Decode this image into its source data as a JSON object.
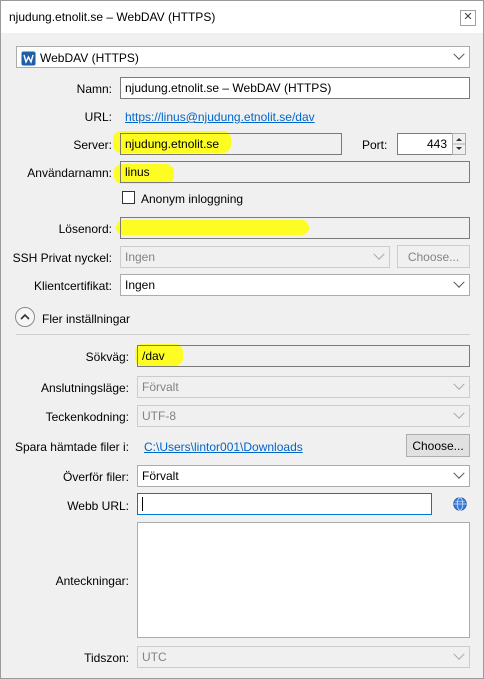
{
  "window": {
    "title": "njudung.etnolit.se – WebDAV (HTTPS)",
    "close_glyph": "✕"
  },
  "protocol": {
    "value": "WebDAV (HTTPS)"
  },
  "fields": {
    "name_label": "Namn:",
    "name_value": "njudung.etnolit.se – WebDAV (HTTPS)",
    "url_label": "URL:",
    "url_value": "https://linus@njudung.etnolit.se/dav",
    "server_label": "Server:",
    "server_value": "njudung.etnolit.se",
    "port_label": "Port:",
    "port_value": "443",
    "username_label": "Användarnamn:",
    "username_value": "linus",
    "anon_label": "Anonym inloggning",
    "password_label": "Lösenord:",
    "password_value": "",
    "ssh_label": "SSH Privat nyckel:",
    "ssh_value": "Ingen",
    "ssh_choose": "Choose...",
    "cert_label": "Klientcertifikat:",
    "cert_value": "Ingen"
  },
  "more": {
    "toggle_label": "Fler inställningar",
    "path_label": "Sökväg:",
    "path_value": "/dav",
    "conn_label": "Anslutningsläge:",
    "conn_value": "Förvalt",
    "encoding_label": "Teckenkodning:",
    "encoding_value": "UTF-8",
    "download_label": "Spara hämtade filer i:",
    "download_value": "C:\\Users\\lintor001\\Downloads",
    "download_choose": "Choose...",
    "transfer_label": "Överför filer:",
    "transfer_value": "Förvalt",
    "weburl_label": "Webb URL:",
    "weburl_value": "",
    "notes_label": "Anteckningar:",
    "notes_value": "",
    "timezone_label": "Tidszon:",
    "timezone_value": "UTC"
  },
  "icons": {
    "protocol": "webdav-globe-icon",
    "browser": "globe-icon",
    "toggle": "chevron-up-icon"
  },
  "colors": {
    "highlight": "#ffff00",
    "link": "#0066cc",
    "focus": "#0078d7"
  }
}
